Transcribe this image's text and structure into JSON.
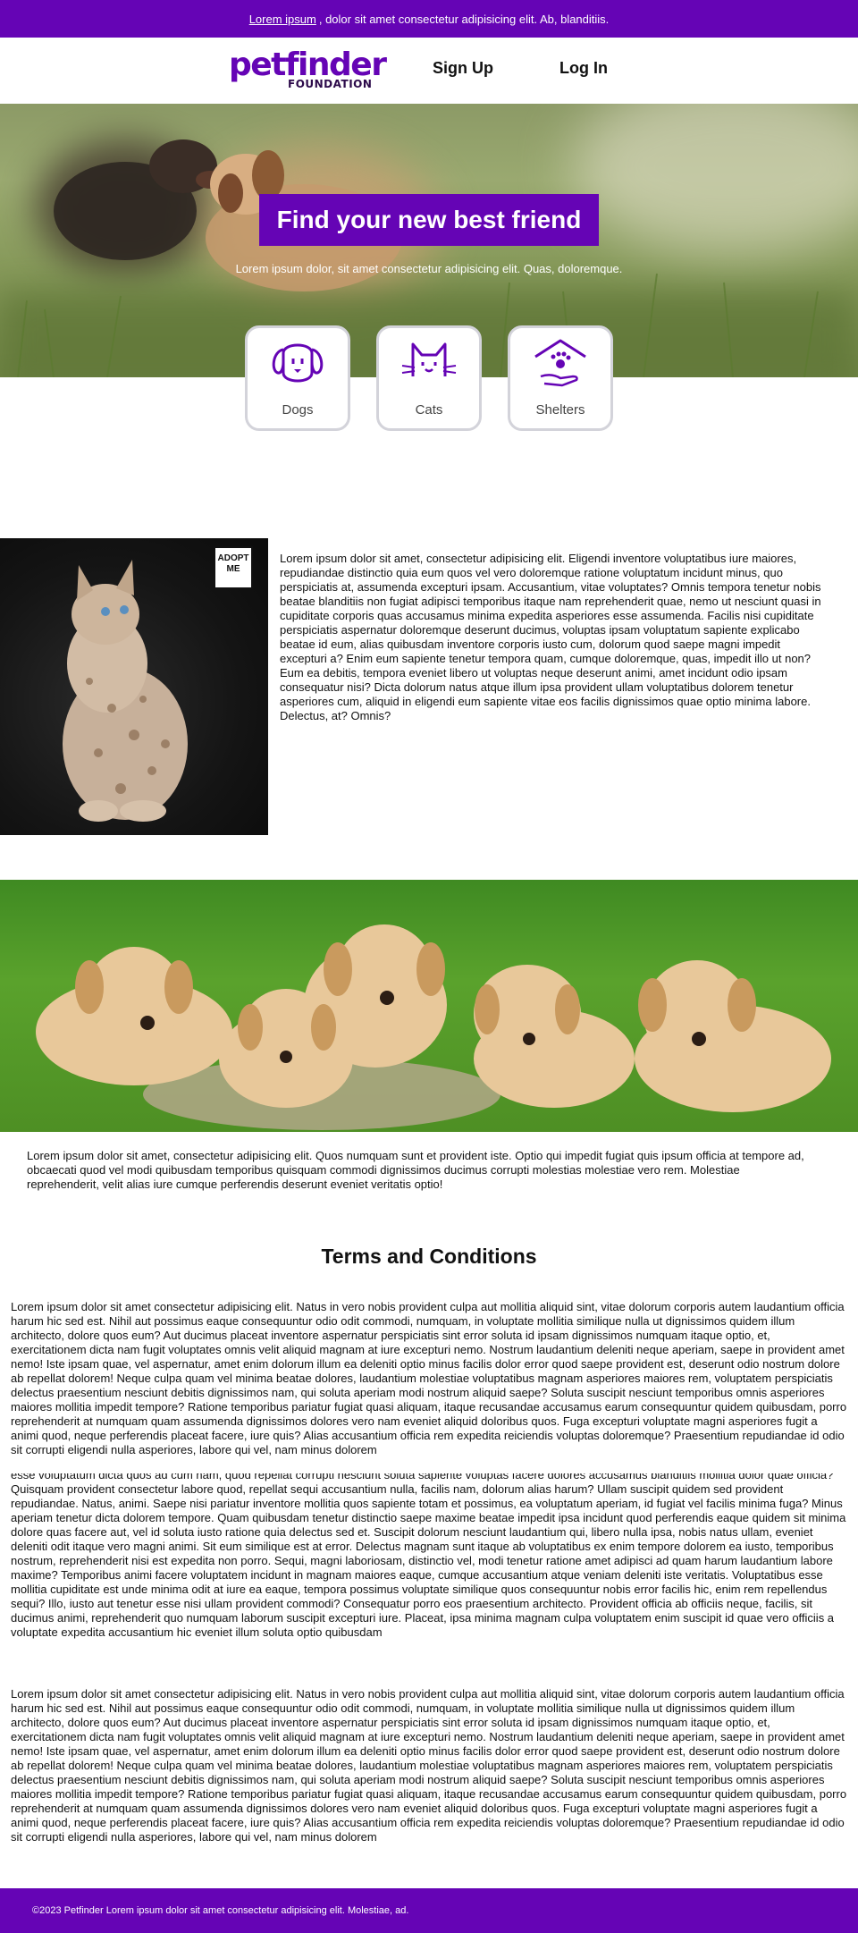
{
  "announcement": {
    "link_text": "Lorem ipsum",
    "text": ", dolor sit amet consectetur adipisicing elit. Ab, blanditiis."
  },
  "header": {
    "logo_word": "petfinder",
    "logo_sub": "FOUNDATION",
    "nav": [
      "Sign Up",
      "Log In"
    ]
  },
  "hero": {
    "title": "Find your new best friend",
    "subtitle": "Lorem ipsum dolor, sit amet consectetur adipisicing elit. Quas, doloremque."
  },
  "categories": [
    {
      "label": "Dogs",
      "icon": "dog-icon"
    },
    {
      "label": "Cats",
      "icon": "cat-icon"
    },
    {
      "label": "Shelters",
      "icon": "shelter-icon"
    }
  ],
  "kitten_section": {
    "badge": "ADOPT ME",
    "text": "Lorem ipsum dolor sit amet, consectetur adipisicing elit. Eligendi inventore voluptatibus iure maiores, repudiandae distinctio quia eum quos vel vero doloremque ratione voluptatum incidunt minus, quo perspiciatis at, assumenda excepturi ipsam. Accusantium, vitae voluptates? Omnis tempora tenetur nobis beatae blanditiis non fugiat adipisci temporibus itaque nam reprehenderit quae, nemo ut nesciunt quasi in cupiditate corporis quas accusamus minima expedita asperiores esse assumenda. Facilis nisi cupiditate perspiciatis aspernatur doloremque deserunt ducimus, voluptas ipsam voluptatum sapiente explicabo beatae id eum, alias quibusdam inventore corporis iusto cum, dolorum quod saepe magni impedit excepturi a? Enim eum sapiente tenetur tempora quam, cumque doloremque, quas, impedit illo ut non? Eum ea debitis, tempora eveniet libero ut voluptas neque deserunt animi, amet incidunt odio ipsam consequatur nisi? Dicta dolorum natus atque illum ipsa provident ullam voluptatibus dolorem tenetur asperiores cum, aliquid in eligendi eum sapiente vitae eos facilis dignissimos quae optio minima labore. Delectus, at? Omnis?"
  },
  "puppies_section": {
    "text": "Lorem ipsum dolor sit amet, consectetur adipisicing elit. Quos numquam sunt et provident iste. Optio qui impedit fugiat quis ipsum officia at tempore ad, obcaecati quod vel modi quibusdam temporibus quisquam commodi dignissimos ducimus corrupti molestias molestiae vero rem. Molestiae reprehenderit, velit alias iure cumque perferendis deserunt eveniet veritatis optio!"
  },
  "terms": {
    "title": "Terms and Conditions",
    "para1": "Lorem ipsum dolor sit amet consectetur adipisicing elit. Natus in vero nobis provident culpa aut mollitia aliquid sint, vitae dolorum corporis autem laudantium officia harum hic sed est. Nihil aut possimus eaque consequuntur odio odit commodi, numquam, in voluptate mollitia similique nulla ut dignissimos quidem illum architecto, dolore quos eum? Aut ducimus placeat inventore aspernatur perspiciatis sint error soluta id ipsam dignissimos numquam itaque optio, et, exercitationem dicta nam fugit voluptates omnis velit aliquid magnam at iure excepturi nemo. Nostrum laudantium deleniti neque aperiam, saepe in provident amet nemo! Iste ipsam quae, vel aspernatur, amet enim dolorum illum ea deleniti optio minus facilis dolor error quod saepe provident est, deserunt odio nostrum dolore ab repellat dolorem! Neque culpa quam vel minima beatae dolores, laudantium molestiae voluptatibus magnam asperiores maiores rem, voluptatem perspiciatis delectus praesentium nesciunt debitis dignissimos nam, qui soluta aperiam modi nostrum aliquid saepe? Soluta suscipit nesciunt temporibus omnis asperiores maiores mollitia impedit tempore? Ratione temporibus pariatur fugiat quasi aliquam, itaque recusandae accusamus earum consequuntur quidem quibusdam, porro reprehenderit at numquam quam assumenda dignissimos dolores vero nam eveniet aliquid doloribus quos. Fuga excepturi voluptate magni asperiores fugit a animi quod, neque perferendis placeat facere, iure quis? Alias accusantium officia rem expedita reiciendis voluptas doloremque? Praesentium repudiandae id odio sit corrupti eligendi nulla asperiores, labore qui vel, nam minus dolorem",
    "para2": "esse voluptatum dicta quos ad cum nam, quod repellat corrupti nesciunt soluta sapiente voluptas facere dolores accusamus blanditiis mollitia dolor quae officia? Quisquam provident consectetur labore quod, repellat sequi accusantium nulla, facilis nam, dolorum alias harum? Ullam suscipit quidem sed provident repudiandae. Natus, animi. Saepe nisi pariatur inventore mollitia quos sapiente totam et possimus, ea voluptatum aperiam, id fugiat vel facilis minima fuga? Minus aperiam tenetur dicta dolorem tempore. Quam quibusdam tenetur distinctio saepe maxime beatae impedit ipsa incidunt quod perferendis eaque quidem sit minima dolore quas facere aut, vel id soluta iusto ratione quia delectus sed et. Suscipit dolorum nesciunt laudantium qui, libero nulla ipsa, nobis natus ullam, eveniet deleniti odit itaque vero magni animi. Sit eum similique est at error. Delectus magnam sunt itaque ab voluptatibus ex enim tempore dolorem ea iusto, temporibus nostrum, reprehenderit nisi est expedita non porro. Sequi, magni laboriosam, distinctio vel, modi tenetur ratione amet adipisci ad quam harum laudantium labore maxime? Temporibus animi facere voluptatem incidunt in magnam maiores eaque, cumque accusantium atque veniam deleniti iste veritatis. Voluptatibus esse mollitia cupiditate est unde minima odit at iure ea eaque, tempora possimus voluptate similique quos consequuntur nobis error facilis hic, enim rem repellendus sequi? Illo, iusto aut tenetur esse nisi ullam provident commodi? Consequatur porro eos praesentium architecto. Provident officia ab officiis neque, facilis, sit ducimus animi, reprehenderit quo numquam laborum suscipit excepturi iure. Placeat, ipsa minima magnam culpa voluptatem enim suscipit id quae vero officiis a voluptate expedita accusantium hic eveniet illum soluta optio quibusdam",
    "para3": "Lorem ipsum dolor sit amet consectetur adipisicing elit. Natus in vero nobis provident culpa aut mollitia aliquid sint, vitae dolorum corporis autem laudantium officia harum hic sed est. Nihil aut possimus eaque consequuntur odio odit commodi, numquam, in voluptate mollitia similique nulla ut dignissimos quidem illum architecto, dolore quos eum? Aut ducimus placeat inventore aspernatur perspiciatis sint error soluta id ipsam dignissimos numquam itaque optio, et, exercitationem dicta nam fugit voluptates omnis velit aliquid magnam at iure excepturi nemo. Nostrum laudantium deleniti neque aperiam, saepe in provident amet nemo! Iste ipsam quae, vel aspernatur, amet enim dolorum illum ea deleniti optio minus facilis dolor error quod saepe provident est, deserunt odio nostrum dolore ab repellat dolorem! Neque culpa quam vel minima beatae dolores, laudantium molestiae voluptatibus magnam asperiores maiores rem, voluptatem perspiciatis delectus praesentium nesciunt debitis dignissimos nam, qui soluta aperiam modi nostrum aliquid saepe? Soluta suscipit nesciunt temporibus omnis asperiores maiores mollitia impedit tempore? Ratione temporibus pariatur fugiat quasi aliquam, itaque recusandae accusamus earum consequuntur quidem quibusdam, porro reprehenderit at numquam quam assumenda dignissimos dolores vero nam eveniet aliquid doloribus quos. Fuga excepturi voluptate magni asperiores fugit a animi quod, neque perferendis placeat facere, iure quis? Alias accusantium officia rem expedita reiciendis voluptas doloremque? Praesentium repudiandae id odio sit corrupti eligendi nulla asperiores, labore qui vel, nam minus dolorem"
  },
  "footer": {
    "text": "©2023 Petfinder Lorem ipsum dolor sit amet consectetur adipisicing elit. Molestiae, ad."
  },
  "colors": {
    "brand_purple": "#6504b5",
    "card_border": "#d3d3da"
  }
}
